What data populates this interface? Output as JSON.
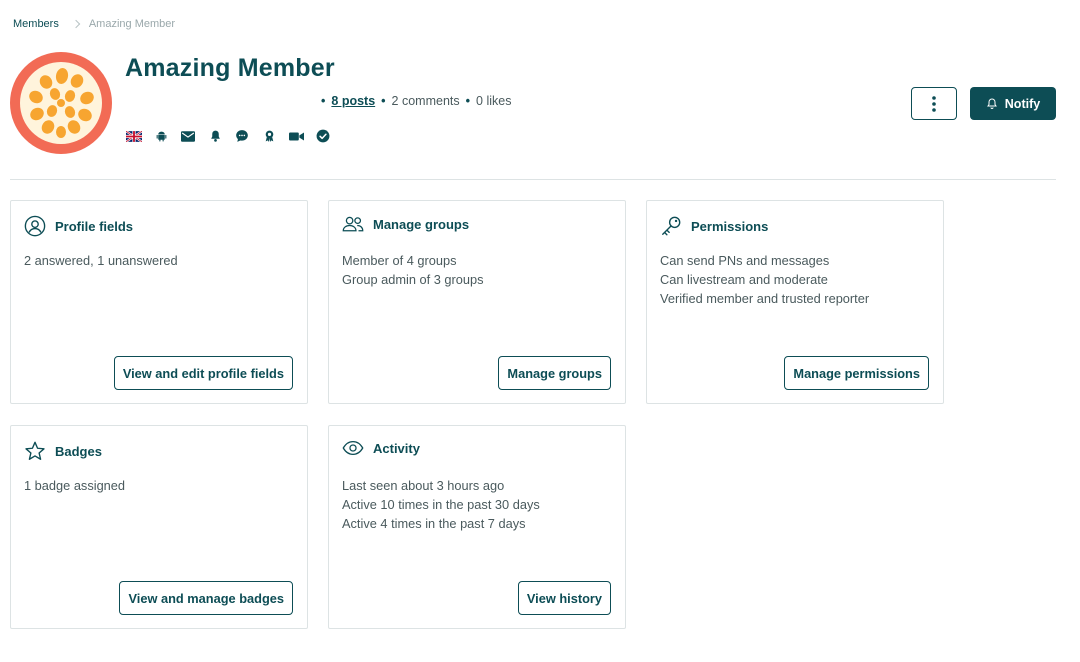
{
  "breadcrumb": {
    "root": "Members",
    "current": "Amazing Member"
  },
  "member": {
    "name": "Amazing Member",
    "posts": "8 posts",
    "comments": "2 comments",
    "likes": "0 likes"
  },
  "status_icons": [
    "uk-flag-icon",
    "android-icon",
    "mail-icon",
    "bell-icon",
    "chat-icon",
    "badge-icon",
    "video-icon",
    "verified-check-icon"
  ],
  "header_actions": {
    "notify_label": "Notify"
  },
  "cards": {
    "profile": {
      "title": "Profile fields",
      "lines": [
        "2 answered, 1 unanswered"
      ],
      "button": "View and edit profile fields"
    },
    "groups": {
      "title": "Manage groups",
      "lines": [
        "Member of 4 groups",
        "Group admin of 3 groups"
      ],
      "button": "Manage groups"
    },
    "permissions": {
      "title": "Permissions",
      "lines": [
        "Can send PNs and messages",
        "Can livestream and moderate",
        "Verified member and trusted reporter"
      ],
      "button": "Manage permissions"
    },
    "badges": {
      "title": "Badges",
      "lines": [
        "1 badge assigned"
      ],
      "button": "View and manage badges"
    },
    "activity": {
      "title": "Activity",
      "lines": [
        "Last seen about 3 hours ago",
        "Active 10 times in the past 30 days",
        "Active 4 times in the past 7 days"
      ],
      "button": "View history"
    }
  },
  "colors": {
    "accent": "#0d4d55",
    "avatar_ring": "#f26b55",
    "avatar_dots": "#f7a530",
    "text_muted": "#4a5a5d"
  }
}
